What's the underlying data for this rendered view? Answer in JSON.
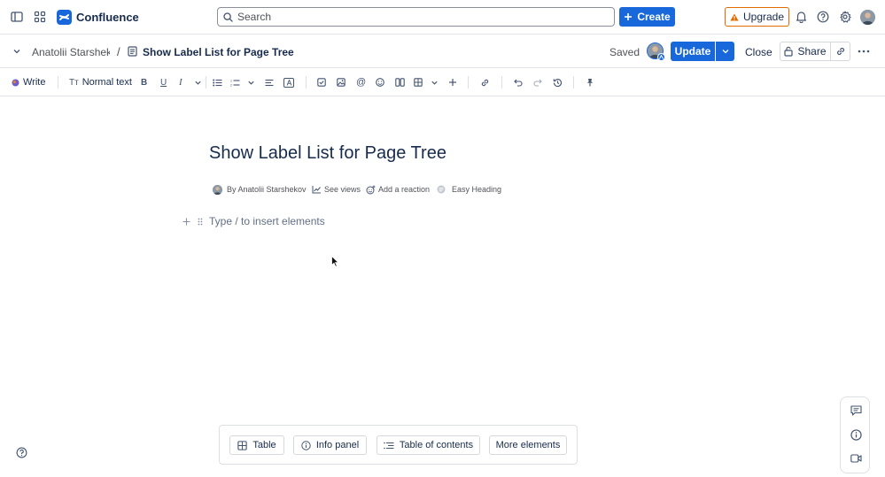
{
  "topnav": {
    "brand": "Confluence",
    "search_placeholder": "Search",
    "create_label": "Create",
    "upgrade_label": "Upgrade"
  },
  "page_header": {
    "breadcrumb_author": "Anatolii Starshekov",
    "breadcrumb_separator": "/",
    "page_title": "Show Label List for Page Tree",
    "save_status": "Saved",
    "update_label": "Update",
    "close_label": "Close",
    "share_label": "Share"
  },
  "toolbar": {
    "write_label": "Write",
    "text_style_label": "Normal text"
  },
  "document": {
    "title": "Show Label List for Page Tree",
    "byline": "By Anatolii Starshekov",
    "see_views_label": "See views",
    "add_reaction_label": "Add a reaction",
    "app_label": "Easy Heading",
    "body_placeholder": "Type / to insert elements"
  },
  "insert_bar": {
    "table_label": "Table",
    "info_panel_label": "Info panel",
    "toc_label": "Table of contents",
    "more_label": "More elements"
  },
  "colors": {
    "accent": "#1868db",
    "upgrade_border": "#e06c00",
    "text": "#172b4d",
    "subtle_text": "#505258"
  }
}
